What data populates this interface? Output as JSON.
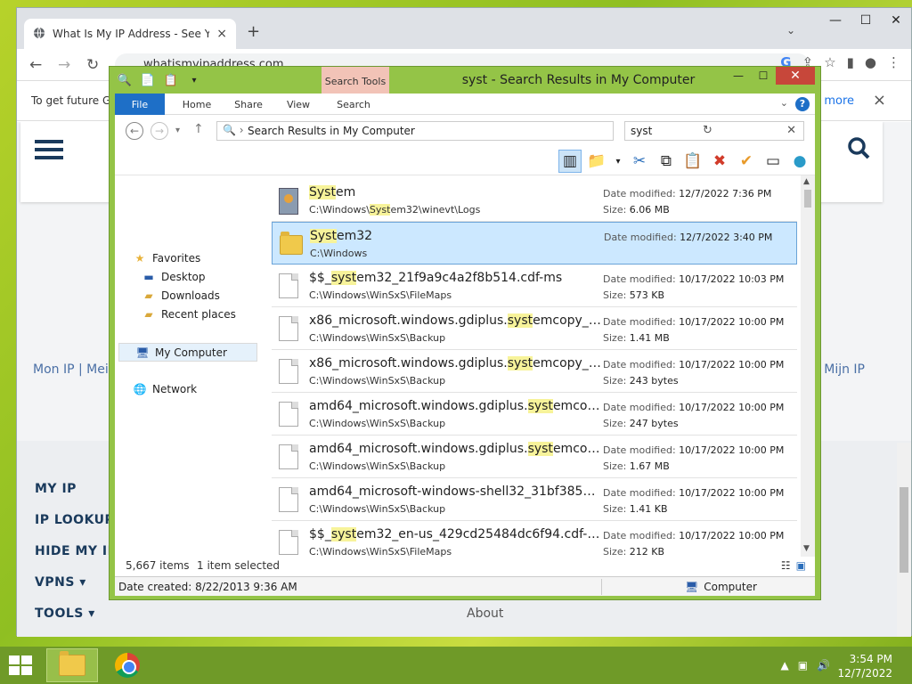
{
  "browser": {
    "tab_title": "What Is My IP Address - See You",
    "tab_close": "×",
    "new_tab": "+",
    "tab_menu": "⌄",
    "url": "whatismyipaddress.com",
    "infobar_text": "To get future G",
    "infobar_more": "n more",
    "infobar_close": "×",
    "window_controls": [
      "—",
      "☐",
      "✕"
    ]
  },
  "website": {
    "lang_left": "Mon IP | Mei",
    "lang_right": "Mijn IP",
    "footer_items": [
      "MY IP",
      "IP LOOKUP",
      "HIDE MY IP",
      "VPNS ▾",
      "TOOLS ▾"
    ],
    "about": "About"
  },
  "explorer": {
    "title": "syst - Search Results in My Computer",
    "context_tab": "Search Tools",
    "ribbon_tabs": [
      "File",
      "Home",
      "Share",
      "View",
      "Search"
    ],
    "help": "?",
    "address": "Search Results in My Computer",
    "search_value": "syst",
    "nav": {
      "favorites": "Favorites",
      "desktop": "Desktop",
      "downloads": "Downloads",
      "recent": "Recent places",
      "my_computer": "My Computer",
      "network": "Network"
    },
    "date_label": "Date modified:",
    "size_label": "Size:",
    "items": [
      {
        "pre": "",
        "hl": "Syst",
        "post": "em",
        "path_pre": "C:\\Windows\\",
        "path_hl": "Syst",
        "path_post": "em32\\winevt\\Logs",
        "date": "12/7/2022 7:36 PM",
        "size": "6.06 MB",
        "icon": "system-file-icon"
      },
      {
        "pre": "",
        "hl": "Syst",
        "post": "em32",
        "path_pre": "C:\\Windows",
        "path_hl": "",
        "path_post": "",
        "date": "12/7/2022 3:40 PM",
        "size": "",
        "icon": "folder-icon"
      },
      {
        "pre": "$$_",
        "hl": "syst",
        "post": "em32_21f9a9c4a2f8b514.cdf-ms",
        "path_pre": "C:\\Windows\\WinSxS\\FileMaps",
        "path_hl": "",
        "path_post": "",
        "date": "10/17/2022 10:03 PM",
        "size": "573 KB",
        "icon": "file-icon"
      },
      {
        "pre": "x86_microsoft.windows.gdiplus.",
        "hl": "syst",
        "post": "emcopy_31...",
        "path_pre": "C:\\Windows\\WinSxS\\Backup",
        "path_hl": "",
        "path_post": "",
        "date": "10/17/2022 10:00 PM",
        "size": "1.41 MB",
        "icon": "file-icon"
      },
      {
        "pre": "x86_microsoft.windows.gdiplus.",
        "hl": "syst",
        "post": "emcopy_31...",
        "path_pre": "C:\\Windows\\WinSxS\\Backup",
        "path_hl": "",
        "path_post": "",
        "date": "10/17/2022 10:00 PM",
        "size": "243 bytes",
        "icon": "file-icon"
      },
      {
        "pre": "amd64_microsoft.windows.gdiplus.",
        "hl": "syst",
        "post": "emcopy...",
        "path_pre": "C:\\Windows\\WinSxS\\Backup",
        "path_hl": "",
        "path_post": "",
        "date": "10/17/2022 10:00 PM",
        "size": "247 bytes",
        "icon": "file-icon"
      },
      {
        "pre": "amd64_microsoft.windows.gdiplus.",
        "hl": "syst",
        "post": "emcopy...",
        "path_pre": "C:\\Windows\\WinSxS\\Backup",
        "path_hl": "",
        "path_post": "",
        "date": "10/17/2022 10:00 PM",
        "size": "1.67 MB",
        "icon": "file-icon"
      },
      {
        "pre": "amd64_microsoft-windows-shell32_31bf3856a...",
        "hl": "",
        "post": "",
        "path_pre": "C:\\Windows\\WinSxS\\Backup",
        "path_hl": "",
        "path_post": "",
        "date": "10/17/2022 10:00 PM",
        "size": "1.41 KB",
        "icon": "file-icon"
      },
      {
        "pre": "$$_",
        "hl": "syst",
        "post": "em32_en-us_429cd25484dc6f94.cdf-ms",
        "path_pre": "C:\\Windows\\WinSxS\\FileMaps",
        "path_hl": "",
        "path_post": "",
        "date": "10/17/2022 10:00 PM",
        "size": "212 KB",
        "icon": "file-icon"
      }
    ],
    "status_count": "5,667 items",
    "status_selected": "1 item selected",
    "details_created": "Date created: 8/22/2013 9:36 AM",
    "details_location": "Computer"
  },
  "taskbar": {
    "time": "3:54 PM",
    "date": "12/7/2022"
  },
  "colors": {
    "explorer_frame": "#94c447",
    "ribbon_file": "#1e6fc7",
    "highlight": "#f7f39a",
    "selection": "#cce8ff",
    "taskbar": "#6f9a28"
  }
}
